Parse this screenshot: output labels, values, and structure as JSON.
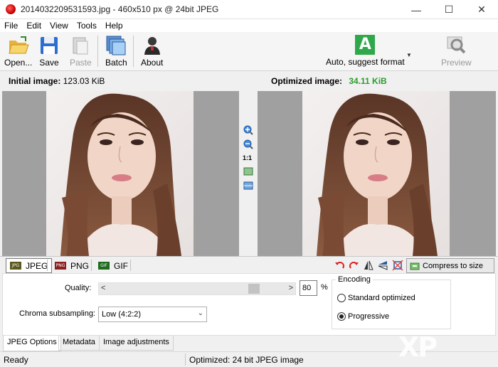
{
  "window": {
    "title": "20140322095315​93.jpg - 460x510 px @ 24bit JPEG"
  },
  "menu": [
    "File",
    "Edit",
    "View",
    "Tools",
    "Help"
  ],
  "toolbar": {
    "open": "Open...",
    "save": "Save",
    "paste": "Paste",
    "batch": "Batch",
    "about": "About",
    "auto": "Auto, suggest format",
    "auto_letter": "A",
    "preview": "Preview"
  },
  "info": {
    "initial_label": "Initial image:",
    "initial_size": "123.03 KiB",
    "optimized_label": "Optimized image:",
    "optimized_size": "34.11 KiB"
  },
  "zoom": {
    "ratio": "1:1"
  },
  "formats": {
    "jpeg": "JPEG",
    "png": "PNG",
    "gif": "GIF",
    "compress": "Compress to size"
  },
  "options": {
    "quality_label": "Quality:",
    "quality_value": "80",
    "quality_unit": "%",
    "quality_level": 80,
    "chroma_label": "Chroma subsampling:",
    "chroma_value": "Low (4:2:2)",
    "encoding_label": "Encoding",
    "standard_label": "Standard optimized",
    "progressive_label": "Progressive",
    "selected_encoding": "progressive"
  },
  "tabs": [
    "JPEG Options",
    "Metadata",
    "Image adjustments"
  ],
  "status": {
    "left": "Ready",
    "right": "Optimized: 24 bit JPEG image"
  },
  "watermark": "XP"
}
